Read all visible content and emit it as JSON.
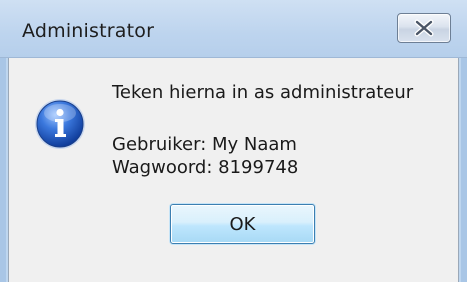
{
  "window": {
    "title": "Administrator",
    "close_icon": "close-icon"
  },
  "dialog": {
    "icon": "information-icon",
    "message": "Teken hierna in as administrateur",
    "user_line": "Gebruiker: My Naam",
    "password_line": "Wagwoord: 8199748"
  },
  "buttons": {
    "ok_label": "OK"
  },
  "colors": {
    "titlebar": "#bdd4ee",
    "content_background": "#f0f0f0",
    "button_border": "#3c7fb1",
    "icon_blue": "#2b63c6"
  }
}
